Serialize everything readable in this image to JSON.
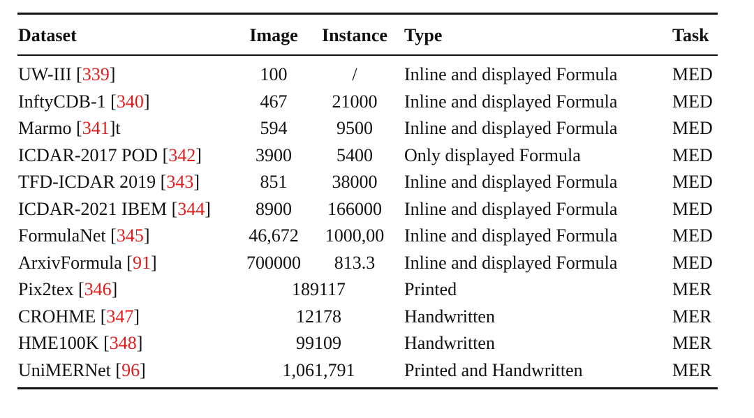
{
  "table": {
    "headers": {
      "dataset": "Dataset",
      "image": "Image",
      "instance": "Instance",
      "type": "Type",
      "task": "Task"
    },
    "ref_color": "#e21b1b",
    "rows": [
      {
        "name": "UW-III ",
        "ref": "339",
        "suffix": "",
        "image": "100",
        "instance": "/",
        "type": "Inline and displayed Formula",
        "task": "MED"
      },
      {
        "name": "InftyCDB-1 ",
        "ref": "340",
        "suffix": "",
        "image": "467",
        "instance": "21000",
        "type": "Inline and displayed Formula",
        "task": "MED"
      },
      {
        "name": "Marmo ",
        "ref": "341",
        "suffix": "t",
        "image": "594",
        "instance": "9500",
        "type": "Inline and displayed Formula",
        "task": "MED"
      },
      {
        "name": "ICDAR-2017 POD ",
        "ref": "342",
        "suffix": "",
        "image": "3900",
        "instance": "5400",
        "type": "Only displayed Formula",
        "task": "MED"
      },
      {
        "name": "TFD-ICDAR 2019  ",
        "ref": "343",
        "suffix": "",
        "image": "851",
        "instance": "38000",
        "type": "Inline and displayed Formula",
        "task": "MED"
      },
      {
        "name": "ICDAR-2021 IBEM ",
        "ref": "344",
        "suffix": "",
        "image": "8900",
        "instance": "166000",
        "type": "Inline and displayed Formula",
        "task": "MED"
      },
      {
        "name": "FormulaNet ",
        "ref": "345",
        "suffix": "",
        "image": "46,672",
        "instance": "1000,00",
        "type": "Inline and displayed Formula",
        "task": "MED"
      },
      {
        "name": "ArxivFormula ",
        "ref": "91",
        "suffix": "",
        "image": "700000",
        "instance": "813.3",
        "type": "Inline and displayed Formula",
        "task": "MED"
      },
      {
        "name": "Pix2tex ",
        "ref": "346",
        "suffix": "",
        "merged": "189117",
        "type": "Printed",
        "task": "MER"
      },
      {
        "name": "CROHME ",
        "ref": "347",
        "suffix": "",
        "merged": "12178",
        "type": "Handwritten",
        "task": "MER"
      },
      {
        "name": "HME100K ",
        "ref": "348",
        "suffix": "",
        "merged": "99109",
        "type": "Handwritten",
        "task": "MER"
      },
      {
        "name": "UniMERNet ",
        "ref": "96",
        "suffix": "",
        "merged": "1,061,791",
        "type": "Printed and Handwritten",
        "task": "MER"
      }
    ]
  }
}
